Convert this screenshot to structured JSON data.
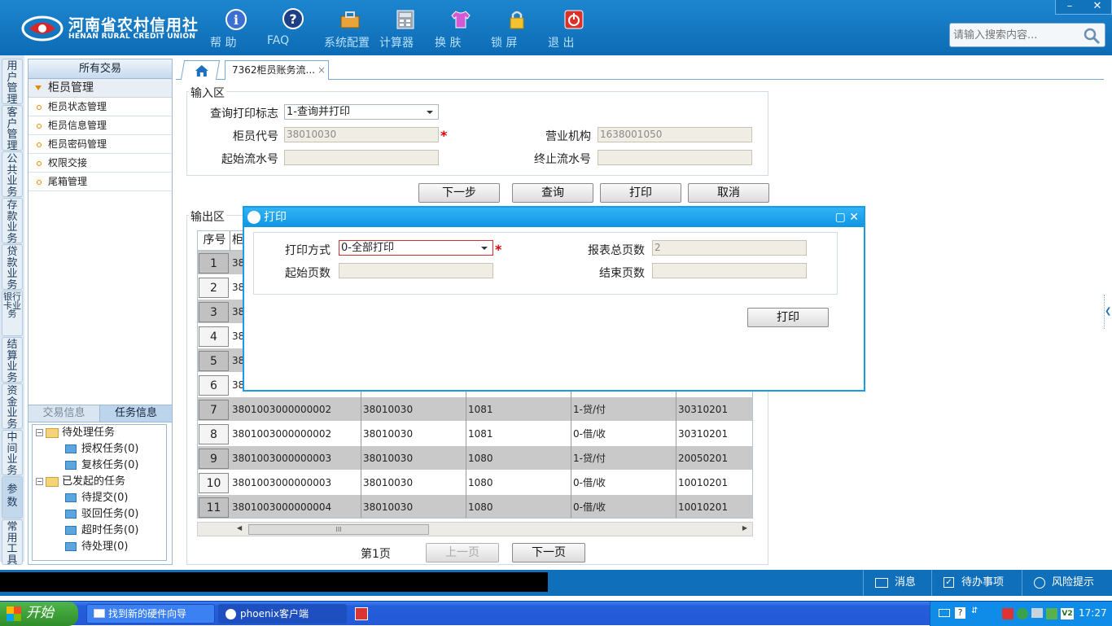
{
  "header": {
    "logo_cn": "河南省农村信用社",
    "logo_en": "HENAN RURAL CREDIT UNION",
    "tools": [
      {
        "label": "帮 助",
        "icon": "info-icon"
      },
      {
        "label": "FAQ",
        "icon": "question-icon"
      },
      {
        "label": "系统配置",
        "icon": "toolbox-icon"
      },
      {
        "label": "计算器",
        "icon": "calculator-icon"
      },
      {
        "label": "换 肤",
        "icon": "shirt-icon"
      },
      {
        "label": "锁 屏",
        "icon": "lock-icon"
      },
      {
        "label": "退 出",
        "icon": "power-icon"
      }
    ],
    "win_min": "–",
    "win_close": "✕",
    "search_placeholder": "请输入搜索内容..."
  },
  "vtabs": [
    "用户管理",
    "客户管理",
    "公共业务",
    "存款业务",
    "贷款业务",
    "银行卡业务",
    "结算业务",
    "资金业务",
    "中间业务",
    "参数",
    "常用工具"
  ],
  "sidebar": {
    "header": "所有交易",
    "group": "柜员管理",
    "items": [
      "柜员状态管理",
      "柜员信息管理",
      "柜员密码管理",
      "权限交接",
      "尾箱管理"
    ],
    "tab_trans": "交易信息",
    "tab_task": "任务信息",
    "tree": {
      "pending": "待处理任务",
      "auth": "授权任务(0)",
      "review": "复核任务(0)",
      "started": "已发起的任务",
      "submit": "待提交(0)",
      "rejected": "驳回任务(0)",
      "timeout": "超时任务(0)",
      "todo": "待处理(0)"
    }
  },
  "tabs": {
    "doc": "7362柜员账务流...",
    "close": "×"
  },
  "input_area": {
    "legend": "输入区",
    "print_flag_label": "查询打印标志",
    "print_flag_value": "1-查询并打印",
    "teller_label": "柜员代号",
    "teller_value": "38010030",
    "org_label": "营业机构",
    "org_value": "1638001050",
    "start_label": "起始流水号",
    "end_label": "终止流水号",
    "required": "*"
  },
  "buttons": {
    "next": "下一步",
    "query": "查询",
    "print": "打印",
    "cancel": "取消"
  },
  "output_area": {
    "legend": "输出区",
    "col_seq": "序号",
    "col_first": "柜",
    "rows": [
      {
        "n": "1",
        "c1": "38",
        "c2": "",
        "c3": "",
        "c4": "",
        "c5": ""
      },
      {
        "n": "2",
        "c1": "38",
        "c2": "",
        "c3": "",
        "c4": "",
        "c5": ""
      },
      {
        "n": "3",
        "c1": "38",
        "c2": "",
        "c3": "",
        "c4": "",
        "c5": ""
      },
      {
        "n": "4",
        "c1": "38",
        "c2": "",
        "c3": "",
        "c4": "",
        "c5": ""
      },
      {
        "n": "5",
        "c1": "38",
        "c2": "",
        "c3": "",
        "c4": "",
        "c5": ""
      },
      {
        "n": "6",
        "c1": "38",
        "c2": "",
        "c3": "",
        "c4": "",
        "c5": ""
      },
      {
        "n": "7",
        "c1": "3801003000000002",
        "c2": "38010030",
        "c3": "1081",
        "c4": "1-贷/付",
        "c5": "30310201"
      },
      {
        "n": "8",
        "c1": "3801003000000002",
        "c2": "38010030",
        "c3": "1081",
        "c4": "0-借/收",
        "c5": "30310201"
      },
      {
        "n": "9",
        "c1": "3801003000000003",
        "c2": "38010030",
        "c3": "1080",
        "c4": "1-贷/付",
        "c5": "20050201"
      },
      {
        "n": "10",
        "c1": "3801003000000003",
        "c2": "38010030",
        "c3": "1080",
        "c4": "0-借/收",
        "c5": "10010201"
      },
      {
        "n": "11",
        "c1": "3801003000000004",
        "c2": "38010030",
        "c3": "1080",
        "c4": "0-借/收",
        "c5": "10010201"
      }
    ],
    "scroll_grip": "III",
    "page_label": "第1页",
    "prev": "上一页",
    "next_page": "下一页"
  },
  "dialog": {
    "title": "打印",
    "mode_label": "打印方式",
    "mode_value": "0-全部打印",
    "total_label": "报表总页数",
    "total_value": "2",
    "start_label": "起始页数",
    "end_label": "结束页数",
    "print_button": "打印",
    "ctl": "▢ ✕"
  },
  "statusbar": {
    "msg": "消息",
    "todo": "待办事项",
    "risk": "风险提示"
  },
  "taskbar": {
    "start": "开始",
    "tasks": [
      "找到新的硬件向导",
      "phoenix客户端"
    ],
    "time": "17:27"
  }
}
